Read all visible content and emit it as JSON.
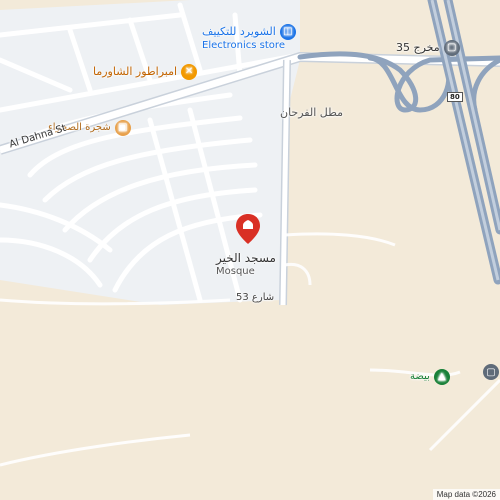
{
  "map": {
    "labels": {
      "electronics_store_ar": "الشويرد للتكييف",
      "electronics_store_en": "Electronics store",
      "restaurant": "امبراطور الشاورما",
      "desert_tree": "شجرة الصحراء",
      "al_dahna_st": "Al Dahna St",
      "exit_35": "مخرج 35",
      "mutal_alfarhan": "مطل الفرحان",
      "mosque_ar": "مسجد الخير",
      "mosque_en": "Mosque",
      "street_53": "شارع 53",
      "route_80": "80",
      "park_label": "بيضة"
    },
    "attribution": "Map data ©2026",
    "colors": {
      "land": "#f3ead9",
      "residential": "#eef0f2",
      "road": "#ffffff",
      "highway": "#8fa3bd",
      "store_pin": "#1a73e8",
      "food_pin": "#f29900",
      "shop_pin": "#e8a04a",
      "mosque_pin": "#d93025",
      "park_pin": "#188038"
    },
    "icons": {
      "store": "store-icon",
      "food": "fork-knife-icon",
      "shop": "shopping-bag-icon",
      "mosque": "place-of-worship-icon",
      "park": "park-icon",
      "transit": "bus-icon"
    }
  }
}
